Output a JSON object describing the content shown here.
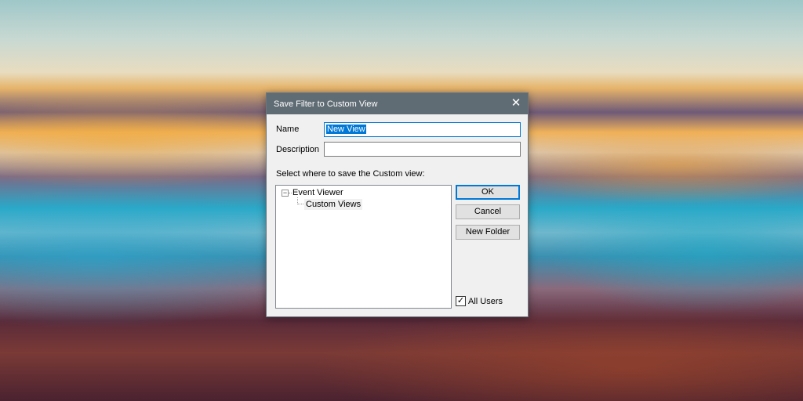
{
  "dialog": {
    "title": "Save Filter to Custom View",
    "name_label": "Name",
    "name_value": "New View",
    "description_label": "Description",
    "description_value": "",
    "location_label": "Select where to save the Custom view:",
    "tree": [
      {
        "label": "Event Viewer",
        "expanded": true
      },
      {
        "label": "Custom Views",
        "selected": true
      }
    ],
    "ok_label": "OK",
    "cancel_label": "Cancel",
    "new_folder_label": "New Folder",
    "all_users_label": "All Users",
    "all_users_checked": true,
    "close_glyph": "✕",
    "collapse_glyph": "−",
    "check_glyph": "✓"
  }
}
